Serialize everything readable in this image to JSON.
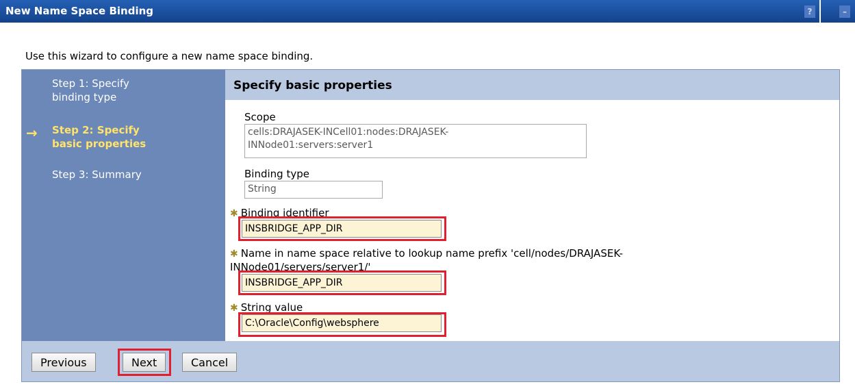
{
  "window": {
    "title": "New Name Space Binding",
    "help_icon": "?",
    "minimize_icon": "–"
  },
  "intro_text": "Use this wizard to configure a new name space binding.",
  "steps": [
    {
      "label_line1": "Step 1: Specify",
      "label_line2": "binding type",
      "active": false
    },
    {
      "label_line1": "Step 2: Specify",
      "label_line2": "basic properties",
      "active": true
    },
    {
      "label_line1": "Step 3: Summary",
      "label_line2": "",
      "active": false
    }
  ],
  "current_step_arrow": "→",
  "panel": {
    "heading": "Specify basic properties",
    "scope": {
      "label": "Scope",
      "value_line1": "cells:DRAJASEK-INCell01:nodes:DRAJASEK-",
      "value_line2": "INNode01:servers:server1"
    },
    "binding_type": {
      "label": "Binding type",
      "value": "String"
    },
    "required_marker": "✱",
    "binding_identifier": {
      "label": "Binding identifier",
      "value": "INSBRIDGE_APP_DIR"
    },
    "name_in_namespace": {
      "label_line1": "Name in name space relative to lookup name prefix 'cell/nodes/DRAJASEK-",
      "label_line2": "INNode01/servers/server1/'",
      "value": "INSBRIDGE_APP_DIR"
    },
    "string_value": {
      "label": "String value",
      "value": "C:\\Oracle\\Config\\websphere"
    }
  },
  "buttons": {
    "previous": "Previous",
    "next": "Next",
    "cancel": "Cancel"
  },
  "colors": {
    "title_bar": "#1a4fa0",
    "step_panel": "#6c88b8",
    "active_step": "#ffe36a",
    "section_header": "#b9c9e2",
    "required_input_bg": "#fdf4d6",
    "highlight": "#e0202e"
  }
}
